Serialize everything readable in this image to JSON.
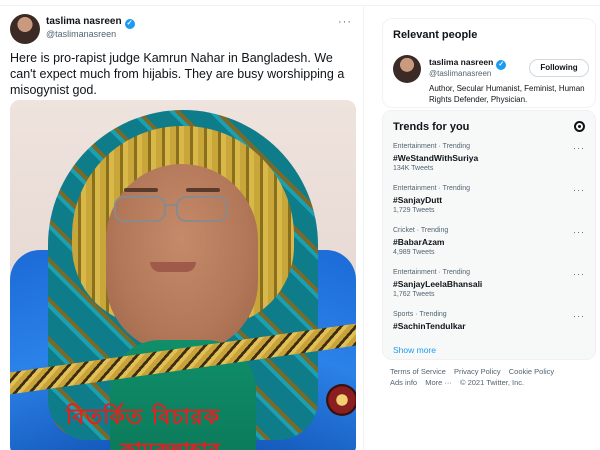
{
  "tweet": {
    "author_name": "taslima nasreen",
    "author_handle": "@taslimanasreen",
    "more_icon": "more-horizontal-icon",
    "verified_icon": "verified-badge-icon",
    "text": "Here is pro-rapist judge Kamrun Nahar in Bangladesh. We can't expect much from hijabis. They are busy worshipping  a misogynist god.",
    "image_caption_line1": "বিতর্কিত বিচারক",
    "image_caption_line2": "কামরুন্নাহার"
  },
  "relevant_people": {
    "title": "Relevant people",
    "person": {
      "name": "taslima nasreen",
      "handle": "@taslimanasreen",
      "bio": "Author, Secular Humanist, Feminist, Human Rights Defender, Physician.",
      "follow_label": "Following"
    }
  },
  "trends": {
    "title": "Trends for you",
    "settings_icon": "settings-icon",
    "items": [
      {
        "category": "Entertainment · Trending",
        "name": "#WeStandWithSuriya",
        "count": "134K Tweets"
      },
      {
        "category": "Entertainment · Trending",
        "name": "#SanjayDutt",
        "count": "1,729 Tweets"
      },
      {
        "category": "Cricket · Trending",
        "name": "#BabarAzam",
        "count": "4,989 Tweets"
      },
      {
        "category": "Entertainment · Trending",
        "name": "#SanjayLeelaBhansali",
        "count": "1,762 Tweets"
      },
      {
        "category": "Sports · Trending",
        "name": "#SachinTendulkar",
        "count": ""
      }
    ],
    "show_more": "Show more"
  },
  "footer": {
    "links": [
      "Terms of Service",
      "Privacy Policy",
      "Cookie Policy"
    ],
    "links2": [
      "Ads info",
      "More ···"
    ],
    "copyright": "© 2021 Twitter, Inc."
  },
  "colors": {
    "accent": "#1d9bf0",
    "text": "#0f1419",
    "secondary": "#536471",
    "caption_red": "#e32020"
  }
}
